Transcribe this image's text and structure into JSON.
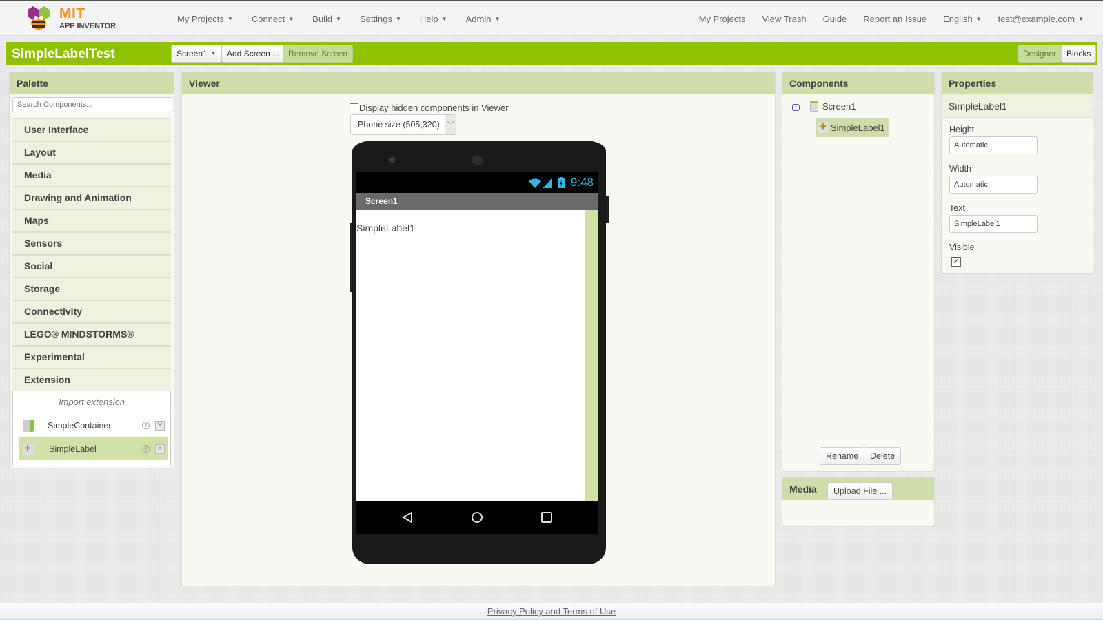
{
  "brand": {
    "line1": "MIT",
    "line2": "APP INVENTOR"
  },
  "nav_left": [
    {
      "label": "My Projects",
      "dropdown": true
    },
    {
      "label": "Connect",
      "dropdown": true
    },
    {
      "label": "Build",
      "dropdown": true
    },
    {
      "label": "Settings",
      "dropdown": true
    },
    {
      "label": "Help",
      "dropdown": true
    },
    {
      "label": "Admin",
      "dropdown": true
    }
  ],
  "nav_right": [
    {
      "label": "My Projects",
      "dropdown": false
    },
    {
      "label": "View Trash",
      "dropdown": false
    },
    {
      "label": "Guide",
      "dropdown": false
    },
    {
      "label": "Report an Issue",
      "dropdown": false
    },
    {
      "label": "English",
      "dropdown": true
    },
    {
      "label": "test@example.com",
      "dropdown": true
    }
  ],
  "caret": "▼",
  "toolbar": {
    "project_title": "SimpleLabelTest",
    "screen_select": "Screen1",
    "add_screen": "Add Screen ...",
    "remove_screen": "Remove Screen",
    "designer": "Designer",
    "blocks": "Blocks"
  },
  "palette": {
    "title": "Palette",
    "search_placeholder": "Search Components...",
    "categories": [
      "User Interface",
      "Layout",
      "Media",
      "Drawing and Animation",
      "Maps",
      "Sensors",
      "Social",
      "Storage",
      "Connectivity",
      "LEGO® MINDSTORMS®",
      "Experimental",
      "Extension"
    ],
    "import_extension": "Import extension",
    "extensions": [
      {
        "name": "SimpleContainer",
        "selected": false
      },
      {
        "name": "SimpleLabel",
        "selected": true
      }
    ],
    "help_glyph": "?",
    "delete_glyph": "✕"
  },
  "viewer": {
    "title": "Viewer",
    "hidden_checkbox_label": "Display hidden components in Viewer",
    "hidden_checked": false,
    "size_select": "Phone size (505,320)",
    "phone": {
      "time": "9:48",
      "screen_title": "Screen1",
      "label_text": "SimpleLabel1"
    }
  },
  "components": {
    "title": "Components",
    "toggle": "−",
    "tree": {
      "screen": "Screen1",
      "children": [
        "SimpleLabel1"
      ]
    },
    "rename": "Rename",
    "delete": "Delete"
  },
  "media": {
    "title": "Media",
    "upload": "Upload File ..."
  },
  "properties": {
    "title": "Properties",
    "component": "SimpleLabel1",
    "height_label": "Height",
    "height_value": "Automatic...",
    "width_label": "Width",
    "width_value": "Automatic...",
    "text_label": "Text",
    "text_value": "SimpleLabel1",
    "visible_label": "Visible",
    "visible_checked": true,
    "check_glyph": "✓"
  },
  "footer": {
    "link": "Privacy Policy and Terms of Use"
  },
  "colors": {
    "accent_green": "#8fc202",
    "panel_header": "#cfddab",
    "status_time": "#33b5e5",
    "logo_orange": "#f2921b"
  }
}
